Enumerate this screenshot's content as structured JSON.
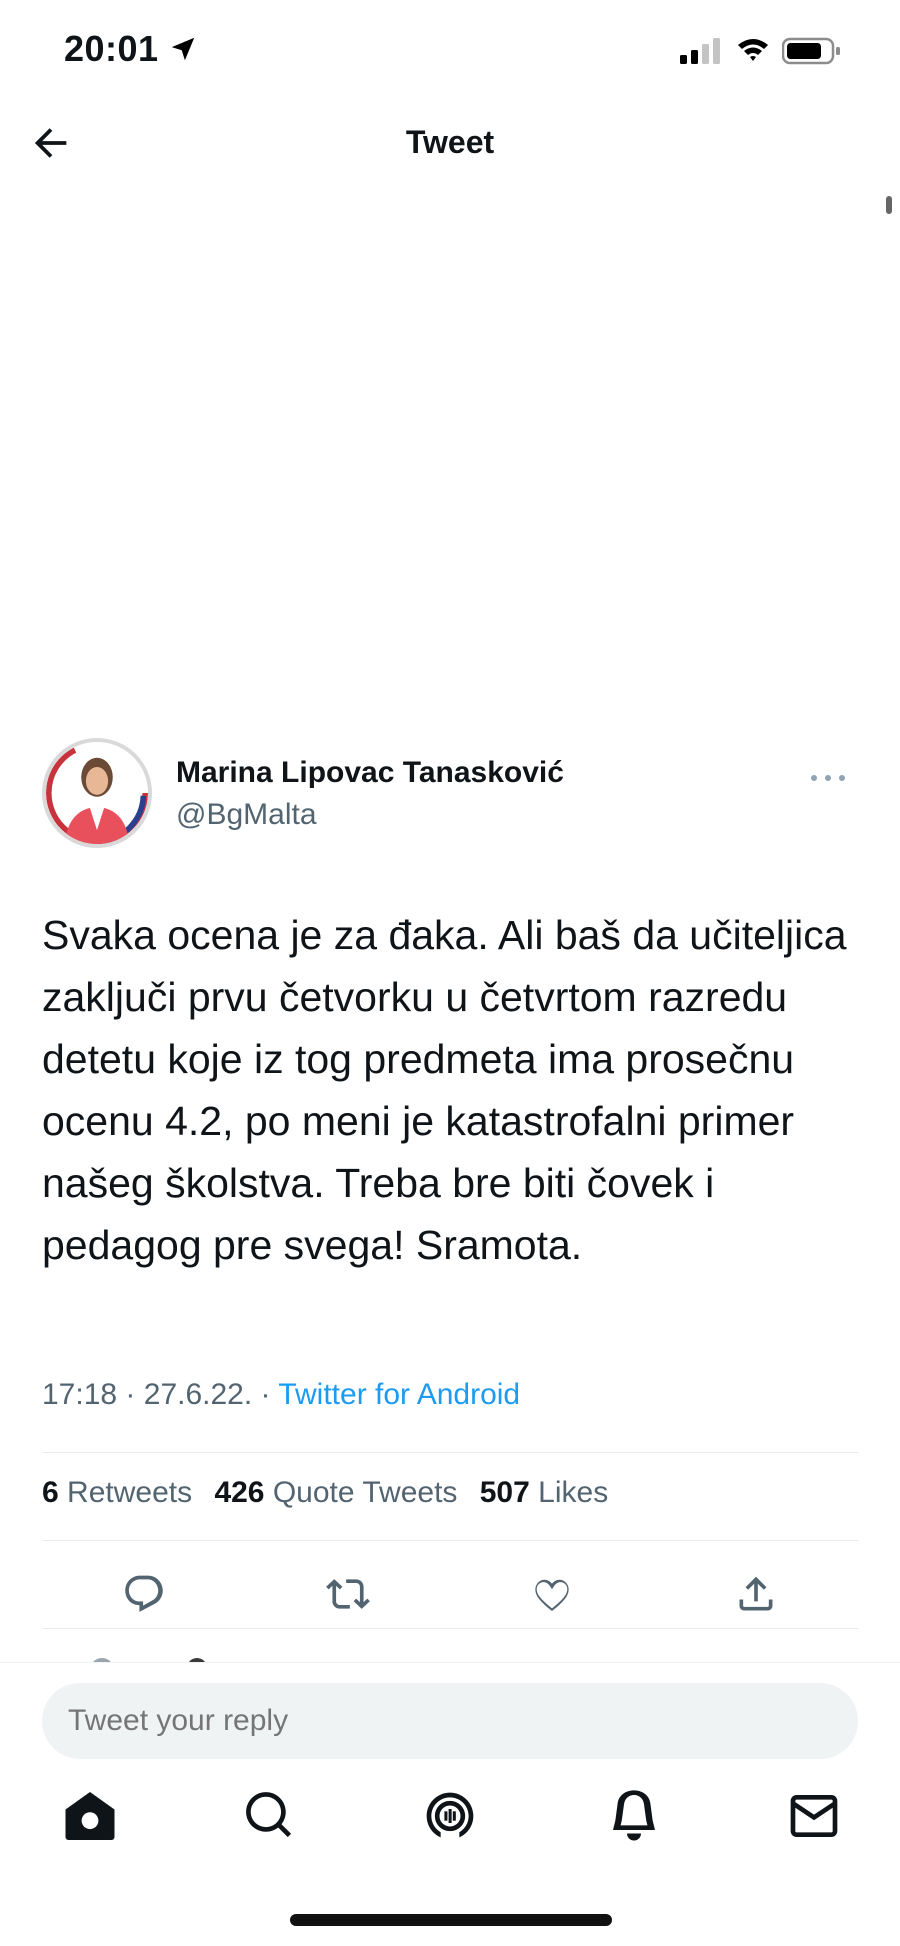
{
  "status_bar": {
    "time": "20:01"
  },
  "header": {
    "title": "Tweet"
  },
  "tweet": {
    "author_name": "Marina Lipovac Tanasković",
    "author_handle": "@BgMalta",
    "text": "Svaka ocena je za đaka. Ali baš da učiteljica zaključi prvu četvorku u četvrtom razredu detetu koje iz tog predmeta ima prosečnu ocenu 4.2, po meni je katastrofalni primer našeg školstva. Treba bre biti čovek i pedagog pre svega! Sramota.",
    "time": "17:18",
    "separator": "·",
    "date": "27.6.22.",
    "source": "Twitter for Android",
    "stats": {
      "retweets_count": "6",
      "retweets_label": "Retweets",
      "quotes_count": "426",
      "quotes_label": "Quote Tweets",
      "likes_count": "507",
      "likes_label": "Likes"
    }
  },
  "reply": {
    "placeholder": "Tweet your reply"
  },
  "colors": {
    "accent": "#1d9bf0",
    "secondary_text": "#536471",
    "primary_text": "#0f1419"
  },
  "icons": {
    "back": "arrow-left-icon",
    "more": "more-dots-icon",
    "actions": [
      "reply-icon",
      "retweet-icon",
      "like-icon",
      "share-icon"
    ],
    "tabs": [
      "home-icon",
      "search-icon",
      "spaces-icon",
      "notifications-icon",
      "messages-icon"
    ]
  }
}
